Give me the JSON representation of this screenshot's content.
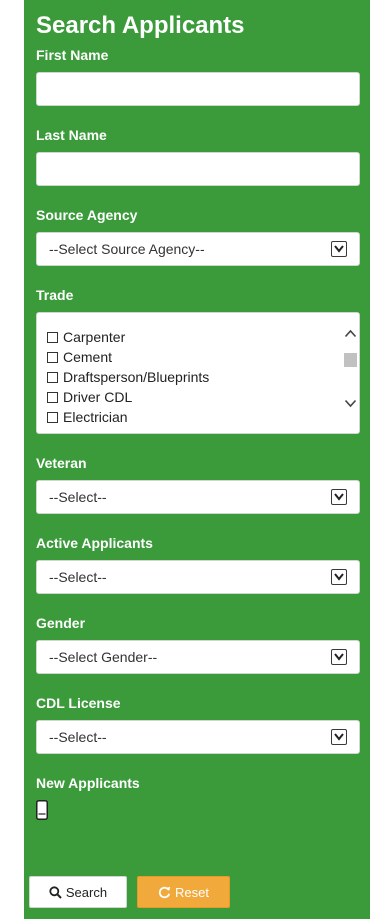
{
  "form": {
    "title": "Search Applicants",
    "first_name": {
      "label": "First Name",
      "value": ""
    },
    "last_name": {
      "label": "Last Name",
      "value": ""
    },
    "source_agency": {
      "label": "Source Agency",
      "selected": "--Select Source Agency--"
    },
    "trade": {
      "label": "Trade",
      "options": [
        "Carpenter",
        "Cement",
        "Draftsperson/Blueprints",
        "Driver CDL",
        "Electrician"
      ]
    },
    "veteran": {
      "label": "Veteran",
      "selected": "--Select--"
    },
    "active_applicants": {
      "label": "Active Applicants",
      "selected": "--Select--"
    },
    "gender": {
      "label": "Gender",
      "selected": "--Select Gender--"
    },
    "cdl_license": {
      "label": "CDL License",
      "selected": "--Select--"
    },
    "new_applicants": {
      "label": "New Applicants",
      "icon": "toggle-icon"
    }
  },
  "actions": {
    "search_label": "Search",
    "search_icon": "search-icon",
    "reset_label": "Reset",
    "reset_icon": "refresh-icon"
  },
  "colors": {
    "panel_bg": "#3b9b3b",
    "reset_bg": "#f2a93b"
  }
}
